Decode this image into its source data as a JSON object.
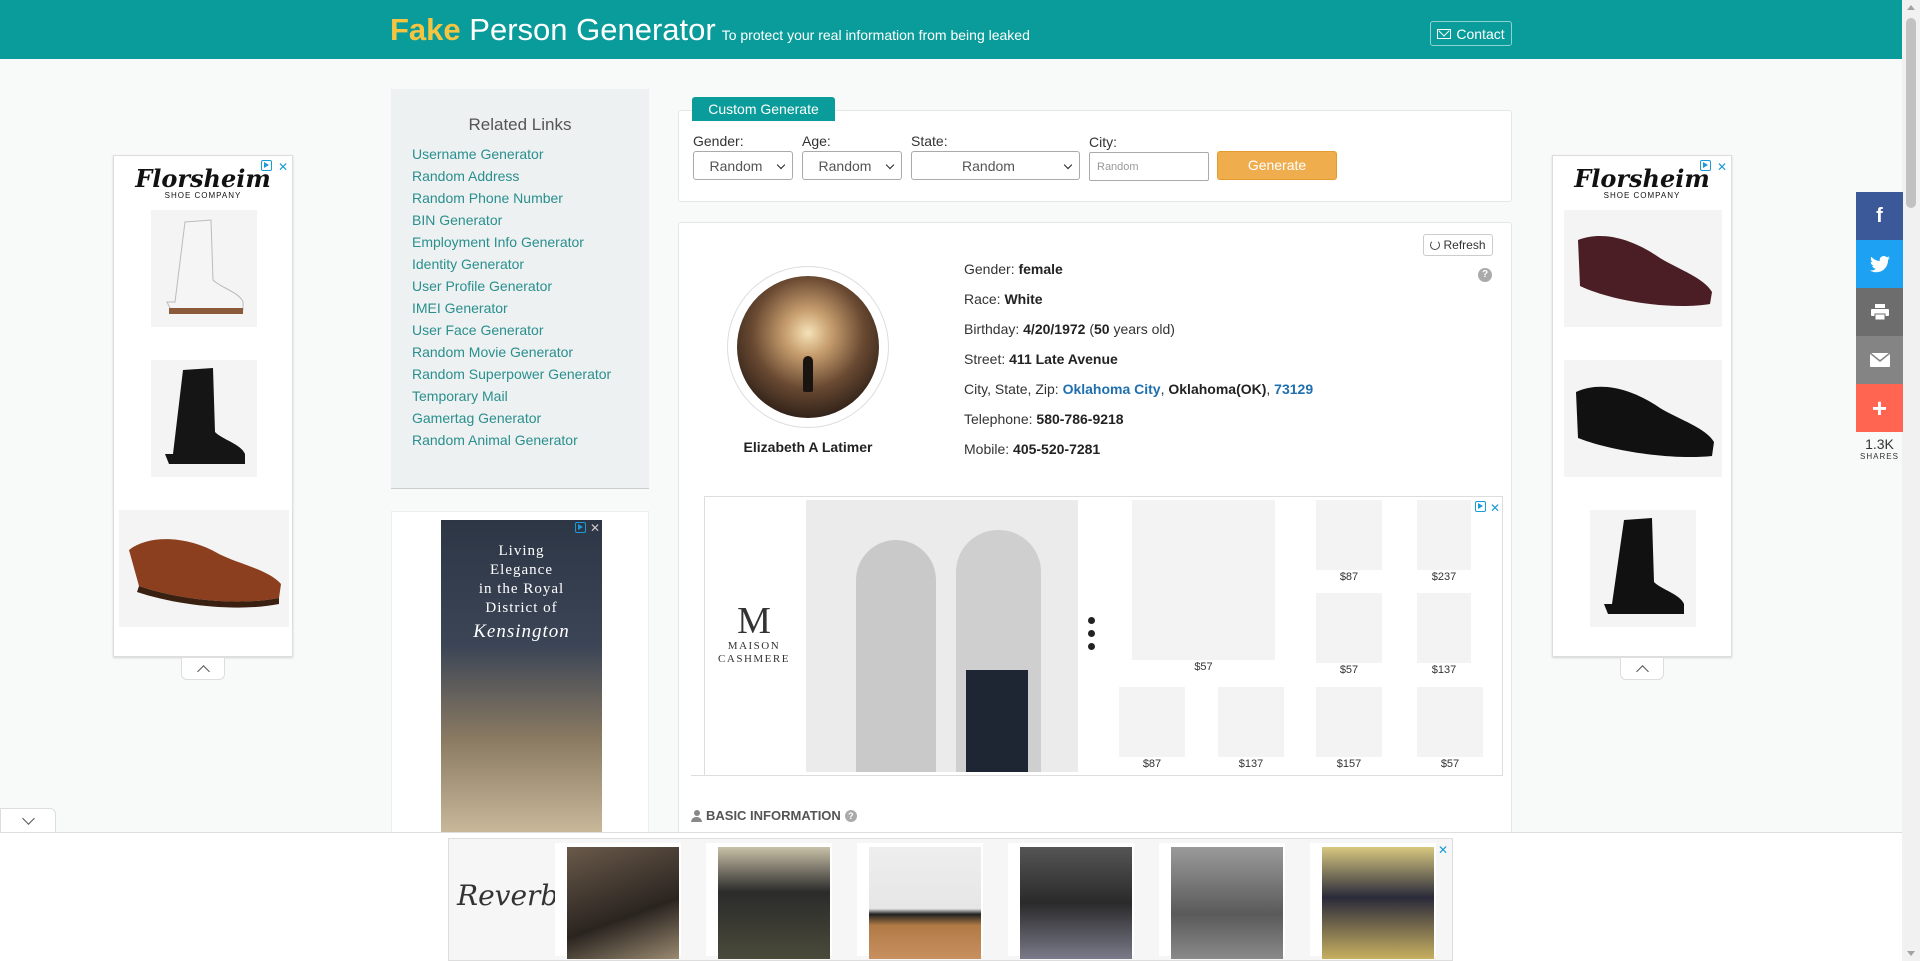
{
  "header": {
    "brand_fake": "Fake",
    "brand_rest": "Person Generator",
    "tagline": "To protect your real information from being leaked",
    "contact_label": "Contact",
    "colors": {
      "bar": "#0a9c9a",
      "accent": "#f5c542"
    }
  },
  "left_ad": {
    "brand": "Florsheim",
    "brand_sub": "SHOE COMPANY"
  },
  "right_ad": {
    "brand": "Florsheim",
    "brand_sub": "SHOE COMPANY"
  },
  "related": {
    "title": "Related Links",
    "links": [
      "Username Generator",
      "Random Address",
      "Random Phone Number",
      "BIN Generator",
      "Employment Info Generator",
      "Identity Generator",
      "User Profile Generator",
      "IMEI Generator",
      "User Face Generator",
      "Random Movie Generator",
      "Random Superpower Generator",
      "Temporary Mail",
      "Gamertag Generator",
      "Random Animal Generator"
    ]
  },
  "kensington_ad": {
    "line1": "Living",
    "line2": "Elegance",
    "line3": "in the Royal",
    "line4": "District of",
    "script": "Kensington"
  },
  "custom_generate": {
    "tab_label": "Custom Generate",
    "gender_label": "Gender:",
    "gender_value": "Random",
    "age_label": "Age:",
    "age_value": "Random",
    "state_label": "State:",
    "state_value": "Random",
    "city_label": "City:",
    "city_placeholder": "Random",
    "generate_label": "Generate"
  },
  "person": {
    "refresh_label": "Refresh",
    "name": "Elizabeth A Latimer",
    "gender_label": "Gender:",
    "gender": "female",
    "race_label": "Race:",
    "race": "White",
    "birthday_label": "Birthday:",
    "birthday": "4/20/1972",
    "age_open": "(",
    "age": "50",
    "age_suffix": "years old)",
    "street_label": "Street:",
    "street": "411 Late Avenue",
    "csz_label": "City, State, Zip:",
    "city": "Oklahoma City",
    "state": "Oklahoma(OK)",
    "zip": "73129",
    "telephone_label": "Telephone:",
    "telephone": "580-786-9218",
    "mobile_label": "Mobile:",
    "mobile": "405-520-7281"
  },
  "maison_ad": {
    "logo_letter": "M",
    "logo_line1": "MAISON",
    "logo_line2": "CASHMERE",
    "prices": [
      "$57",
      "$87",
      "$237",
      "$57",
      "$137",
      "$87",
      "$137",
      "$157",
      "$57"
    ]
  },
  "section": {
    "basic_info": "BASIC INFORMATION"
  },
  "share": {
    "count": "1.3K",
    "label": "SHARES",
    "colors": {
      "facebook": "#3b5998",
      "twitter": "#1da1f2",
      "print": "#6d6d6d",
      "email": "#848484",
      "more": "#ff6550"
    }
  },
  "bottom_ad": {
    "brand": "Reverb"
  }
}
